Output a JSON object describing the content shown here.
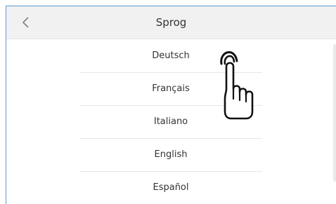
{
  "header": {
    "title": "Sprog",
    "back_icon": "chevron-left-icon"
  },
  "languages": [
    {
      "label": "Deutsch"
    },
    {
      "label": "Français"
    },
    {
      "label": "Italiano"
    },
    {
      "label": "English"
    },
    {
      "label": "Español"
    }
  ],
  "overlay": {
    "icon": "hand-pointer-icon"
  },
  "colors": {
    "header_bg": "#f1f1f1",
    "text": "#333333",
    "frame_border": "#5b9bd5",
    "divider": "#e6e6e6"
  }
}
